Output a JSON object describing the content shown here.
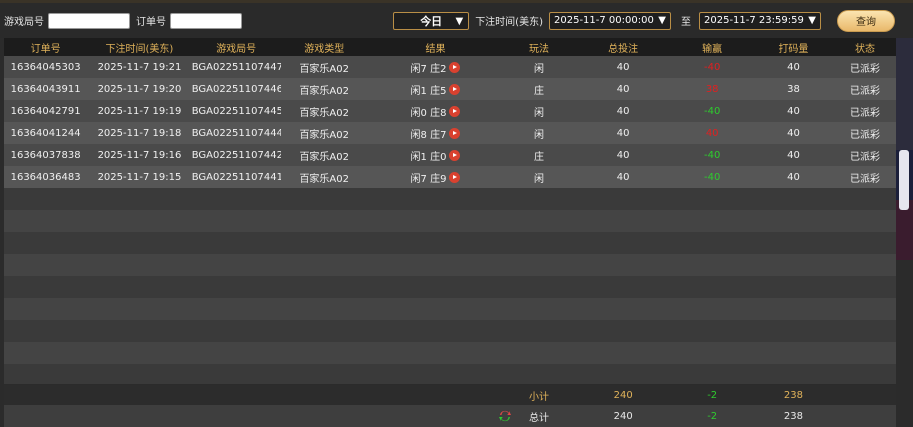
{
  "filters": {
    "round_label": "游戏局号",
    "round_value": "",
    "order_label": "订单号",
    "order_value": "",
    "range_select": "今日",
    "time_label": "下注时间(美东)",
    "start_time": "2025-11-7 00:00:00",
    "to_label": "至",
    "end_time": "2025-11-7 23:59:59",
    "query_label": "查询"
  },
  "table": {
    "headers": [
      "订单号",
      "下注时间(美东)",
      "游戏局号",
      "游戏类型",
      "结果",
      "玩法",
      "总投注",
      "输赢",
      "打码量",
      "状态"
    ],
    "rows": [
      {
        "order": "16364045303",
        "time": "2025-11-7 19:21",
        "round": "BGA02251107447",
        "type": "百家乐A02",
        "result": "闲7 庄2",
        "play": "闲",
        "bet": "40",
        "win": "-40",
        "win_sign": "neg",
        "wash": "40",
        "status": "已派彩"
      },
      {
        "order": "16364043911",
        "time": "2025-11-7 19:20",
        "round": "BGA02251107446",
        "type": "百家乐A02",
        "result": "闲1 庄5",
        "play": "庄",
        "bet": "40",
        "win": "38",
        "win_sign": "neg",
        "wash": "38",
        "status": "已派彩"
      },
      {
        "order": "16364042791",
        "time": "2025-11-7 19:19",
        "round": "BGA02251107445",
        "type": "百家乐A02",
        "result": "闲0 庄8",
        "play": "闲",
        "bet": "40",
        "win": "-40",
        "win_sign": "pos",
        "wash": "40",
        "status": "已派彩"
      },
      {
        "order": "16364041244",
        "time": "2025-11-7 19:18",
        "round": "BGA02251107444",
        "type": "百家乐A02",
        "result": "闲8 庄7",
        "play": "闲",
        "bet": "40",
        "win": "40",
        "win_sign": "neg",
        "wash": "40",
        "status": "已派彩"
      },
      {
        "order": "16364037838",
        "time": "2025-11-7 19:16",
        "round": "BGA02251107442",
        "type": "百家乐A02",
        "result": "闲1 庄0",
        "play": "庄",
        "bet": "40",
        "win": "-40",
        "win_sign": "pos",
        "wash": "40",
        "status": "已派彩"
      },
      {
        "order": "16364036483",
        "time": "2025-11-7 19:15",
        "round": "BGA02251107441",
        "type": "百家乐A02",
        "result": "闲7 庄9",
        "play": "闲",
        "bet": "40",
        "win": "-40",
        "win_sign": "pos",
        "wash": "40",
        "status": "已派彩"
      }
    ]
  },
  "subtotal": {
    "label": "小计",
    "bet": "240",
    "win": "-2",
    "wash": "238"
  },
  "total": {
    "label": "总计",
    "bet": "240",
    "win": "-2",
    "wash": "238"
  },
  "colors": {
    "accent": "#e0b25a",
    "negative": "#e02020",
    "positive": "#2ecc2e"
  },
  "icons": {
    "result_icon": "play-icon",
    "refresh_icon": "refresh-icon"
  }
}
